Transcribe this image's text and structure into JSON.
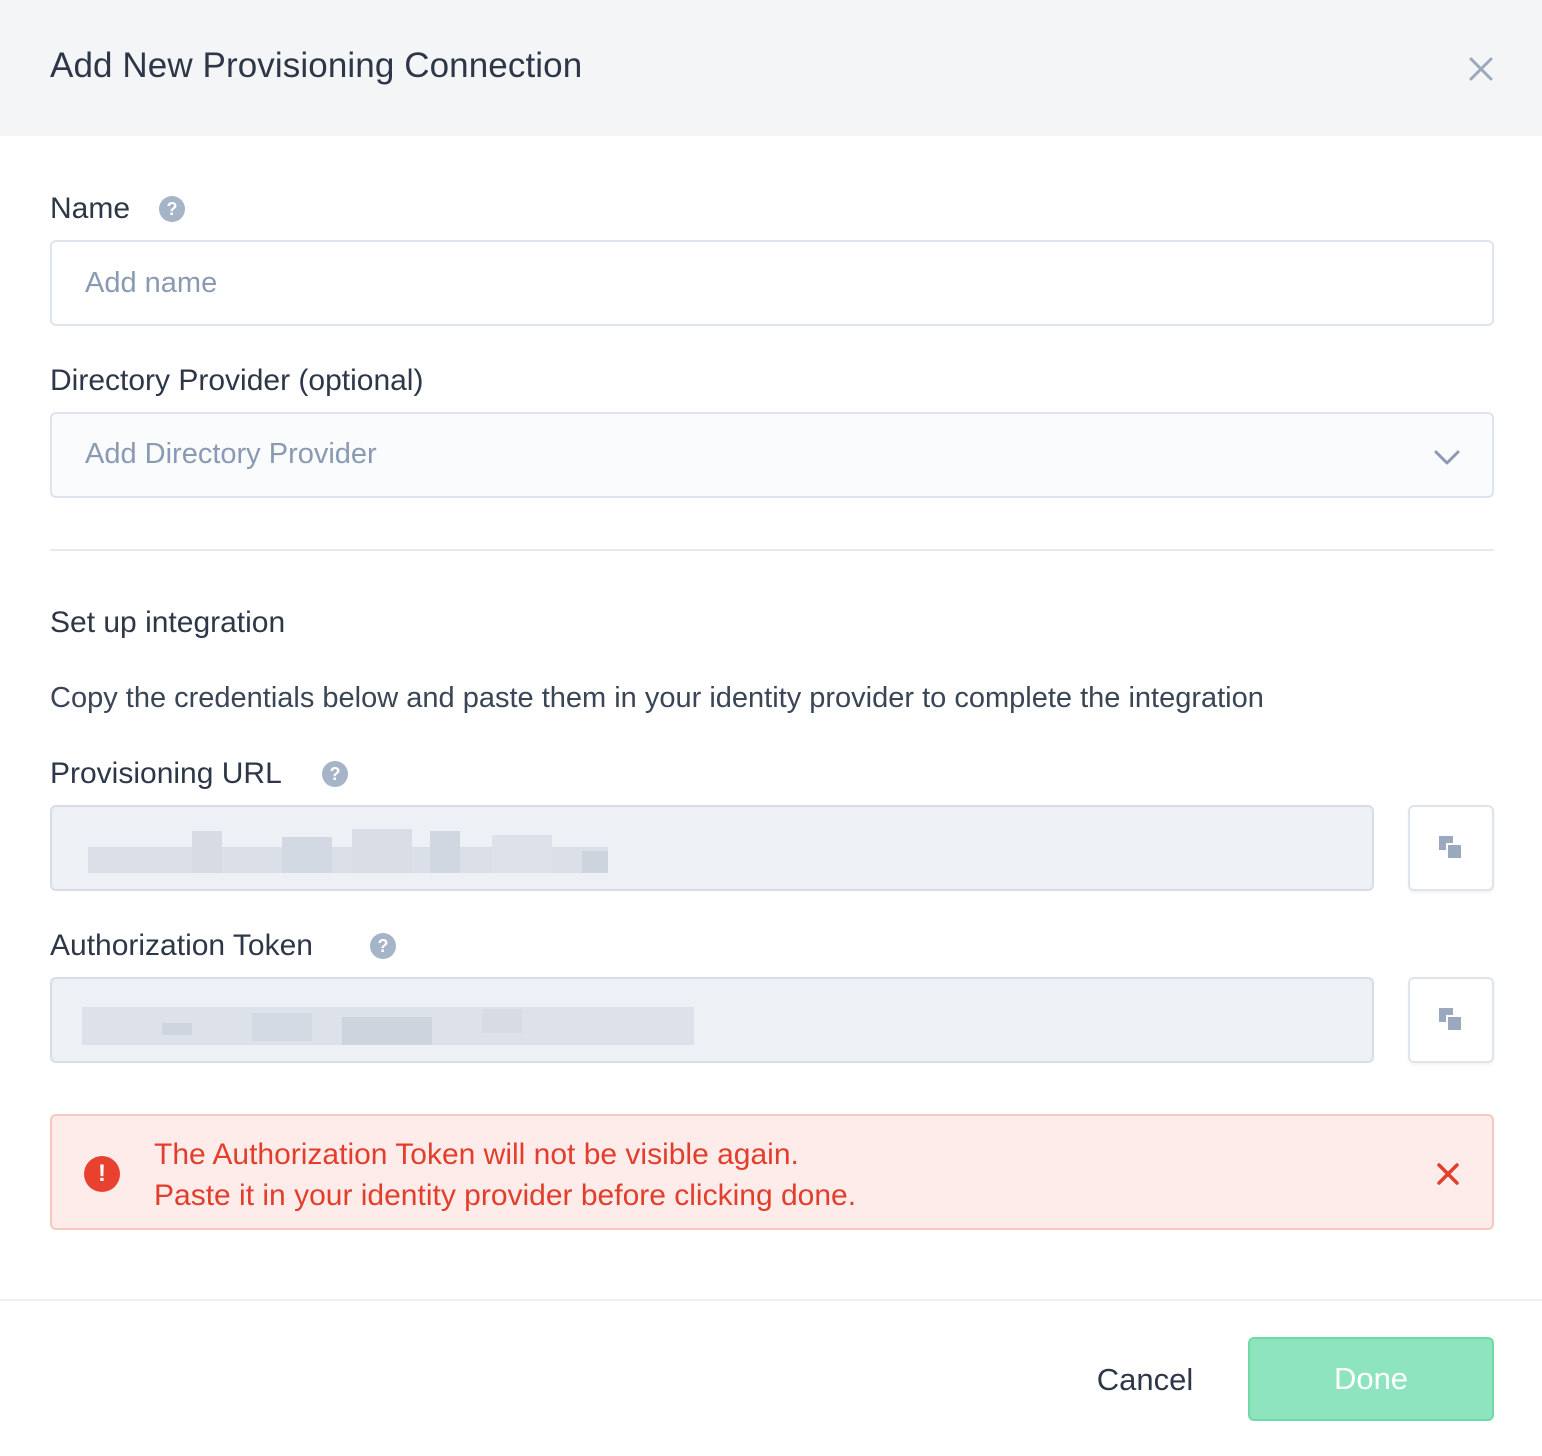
{
  "modal": {
    "title": "Add New Provisioning Connection",
    "close_icon": "close-icon"
  },
  "name_field": {
    "label": "Name",
    "placeholder": "Add name",
    "value": "",
    "help_icon": "question-circle-icon",
    "help_glyph": "?"
  },
  "directory_provider": {
    "label": "Directory Provider (optional)",
    "placeholder": "Add Directory Provider",
    "icon": "chevron-down-icon"
  },
  "integration": {
    "title": "Set up integration",
    "description": "Copy the credentials below and paste them in your identity provider to complete the integration"
  },
  "provisioning_url": {
    "label": "Provisioning URL",
    "value_state": "redacted",
    "help_icon": "question-circle-icon",
    "help_glyph": "?",
    "copy_icon": "copy-icon"
  },
  "authorization_token": {
    "label": "Authorization Token",
    "value_state": "redacted",
    "help_icon": "question-circle-icon",
    "help_glyph": "?",
    "copy_icon": "copy-icon"
  },
  "alert": {
    "icon": "exclamation-circle-icon",
    "icon_glyph": "!",
    "line1": "The Authorization Token will not be visible again.",
    "line2": "Paste it in your identity provider before clicking done.",
    "close_icon": "close-icon",
    "color": "#e33d2b"
  },
  "footer": {
    "cancel_label": "Cancel",
    "done_label": "Done",
    "done_color": "#8ee4bf"
  }
}
